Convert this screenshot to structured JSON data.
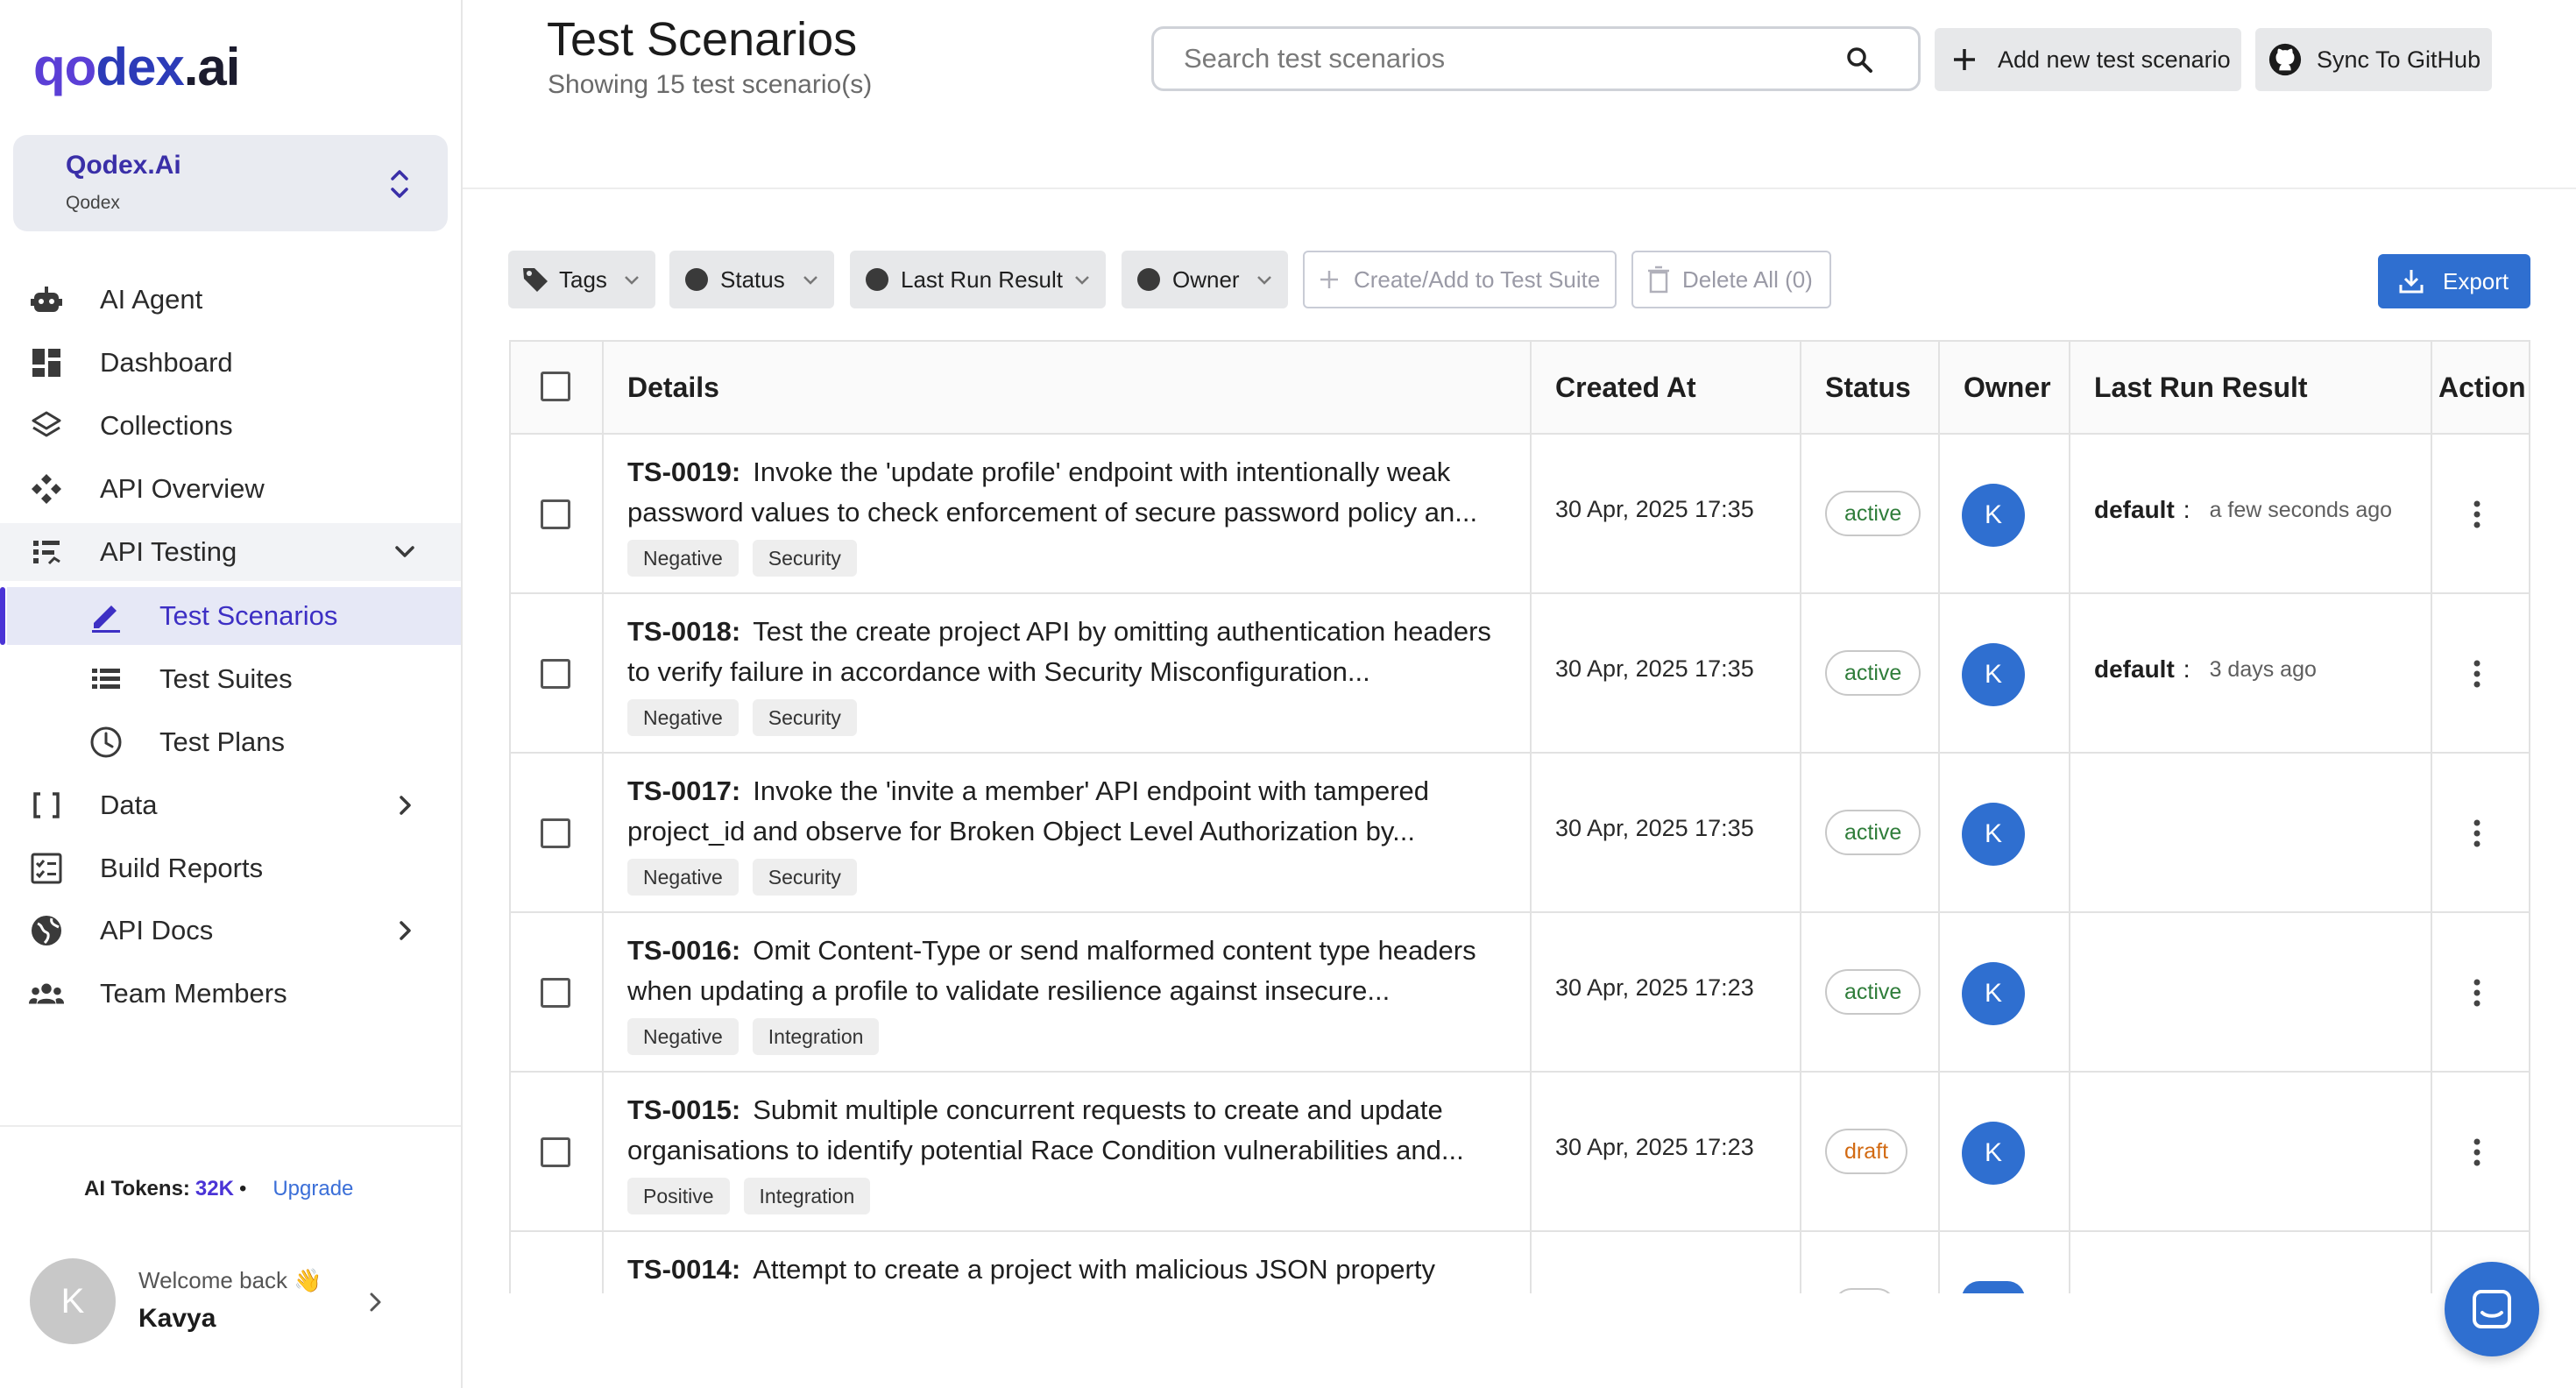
{
  "brand": {
    "logo_p1": "qo",
    "logo_p2": "dex",
    "logo_p3": ".ai"
  },
  "org": {
    "name": "Qodex.Ai",
    "sub": "Qodex"
  },
  "nav": {
    "ai_agent": "AI Agent",
    "dashboard": "Dashboard",
    "collections": "Collections",
    "api_overview": "API Overview",
    "api_testing": "API Testing",
    "test_scenarios": "Test Scenarios",
    "test_suites": "Test Suites",
    "test_plans": "Test Plans",
    "data": "Data",
    "build_reports": "Build Reports",
    "api_docs": "API Docs",
    "team_members": "Team Members"
  },
  "tokens": {
    "label": "AI Tokens:",
    "value": "32K",
    "bullet": "•",
    "upgrade": "Upgrade"
  },
  "user": {
    "initial": "K",
    "welcome": "Welcome back 👋",
    "name": "Kavya"
  },
  "header": {
    "title": "Test Scenarios",
    "subtitle": "Showing 15 test scenario(s)",
    "search_placeholder": "Search test scenarios",
    "add_label": "Add new test scenario",
    "sync_label": "Sync To GitHub"
  },
  "filters": {
    "tags": "Tags",
    "status": "Status",
    "last_run": "Last Run Result",
    "owner": "Owner",
    "create_suite": "Create/Add to Test Suite",
    "delete_all": "Delete All (0)",
    "export": "Export"
  },
  "table": {
    "columns": [
      "Details",
      "Created At",
      "Status",
      "Owner",
      "Last Run Result",
      "Action"
    ],
    "rows": [
      {
        "id": "TS-0019:",
        "text": "Invoke the 'update profile' endpoint with intentionally weak password values to check enforcement of secure password policy an...",
        "tags": [
          "Negative",
          "Security"
        ],
        "created": "30 Apr, 2025 17:35",
        "status": "active",
        "owner": "K",
        "run_env": "default",
        "run_sep": ":",
        "run_time": "a few seconds ago"
      },
      {
        "id": "TS-0018:",
        "text": "Test the create project API by omitting authentication headers to verify failure in accordance with Security Misconfiguration...",
        "tags": [
          "Negative",
          "Security"
        ],
        "created": "30 Apr, 2025 17:35",
        "status": "active",
        "owner": "K",
        "run_env": "default",
        "run_sep": ":",
        "run_time": "3 days ago"
      },
      {
        "id": "TS-0017:",
        "text": "Invoke the 'invite a member' API endpoint with tampered project_id and observe for Broken Object Level Authorization by...",
        "tags": [
          "Negative",
          "Security"
        ],
        "created": "30 Apr, 2025 17:35",
        "status": "active",
        "owner": "K"
      },
      {
        "id": "TS-0016:",
        "text": "Omit Content-Type or send malformed content type headers when updating a profile to validate resilience against insecure...",
        "tags": [
          "Negative",
          "Integration"
        ],
        "created": "30 Apr, 2025 17:23",
        "status": "active",
        "owner": "K"
      },
      {
        "id": "TS-0015:",
        "text": "Submit multiple concurrent requests to create and update organisations to identify potential Race Condition vulnerabilities and...",
        "tags": [
          "Positive",
          "Integration"
        ],
        "created": "30 Apr, 2025 17:23",
        "status": "draft",
        "owner": "K"
      },
      {
        "id": "TS-0014:",
        "text": "Attempt to create a project with malicious JSON property",
        "tags": [],
        "created": "",
        "status": "",
        "owner": ""
      }
    ]
  },
  "colors": {
    "accent": "#4b34d6",
    "primary": "#2f6fd0",
    "active": "#2f7d3a",
    "draft": "#d26a12"
  }
}
